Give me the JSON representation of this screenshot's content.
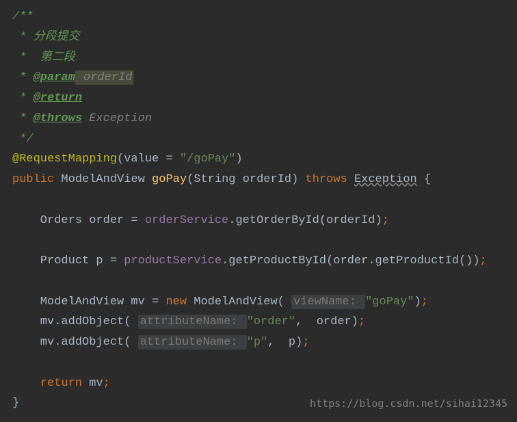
{
  "c1": "/**",
  "c2": " * 分段提交",
  "c3": " *  第二段",
  "c4": " * ",
  "c4tag": "@param",
  "c4param": " orderId",
  "c5": " * ",
  "c5tag": "@return",
  "c6": " * ",
  "c6tag": "@throws",
  "c6ex": " Exception",
  "c7": " */",
  "anno": "@RequestMapping",
  "lp": "(",
  "valueAttr": "value ",
  "eq": "= ",
  "gopayPath": "\"/goPay\"",
  "rp": ")",
  "pub": "public ",
  "mav": "ModelAndView ",
  "methodName": "goPay",
  "sigOpen": "(",
  "paramType": "String ",
  "paramName": "orderId",
  "sigClose": ") ",
  "throws": "throws ",
  "exception": "Exception",
  "brace": " {",
  "l1a": "    Orders order = ",
  "orderSvc": "orderService",
  "l1b": ".",
  "getOrder": "getOrderById",
  "l1c": "(",
  "l1d": "orderId",
  "l1e": ")",
  "semi": ";",
  "l2a": "    Product p = ",
  "prodSvc": "productService",
  "l2b": ".",
  "getProd": "getProductById",
  "l2c": "(",
  "l2d": "order",
  "l2e": ".",
  "getPid": "getProductId",
  "l2f": "())",
  "l3a": "    ModelAndView mv = ",
  "newKw": "new ",
  "mav2": "ModelAndView",
  "l3b": "( ",
  "hintView": "viewName: ",
  "l3c": "\"goPay\"",
  "l3d": ")",
  "l4a": "    mv.",
  "addObj": "addObject",
  "l4b": "( ",
  "hintAttr": "attributeName: ",
  "l4c": "\"order\"",
  "l4d": ",  order)",
  "l5a": "    mv.",
  "l5b": "( ",
  "l5c": "\"p\"",
  "l5d": ",  p)",
  "retKw": "    return ",
  "retVal": "mv",
  "closeBrace": "}",
  "watermark": "https://blog.csdn.net/sihai12345"
}
